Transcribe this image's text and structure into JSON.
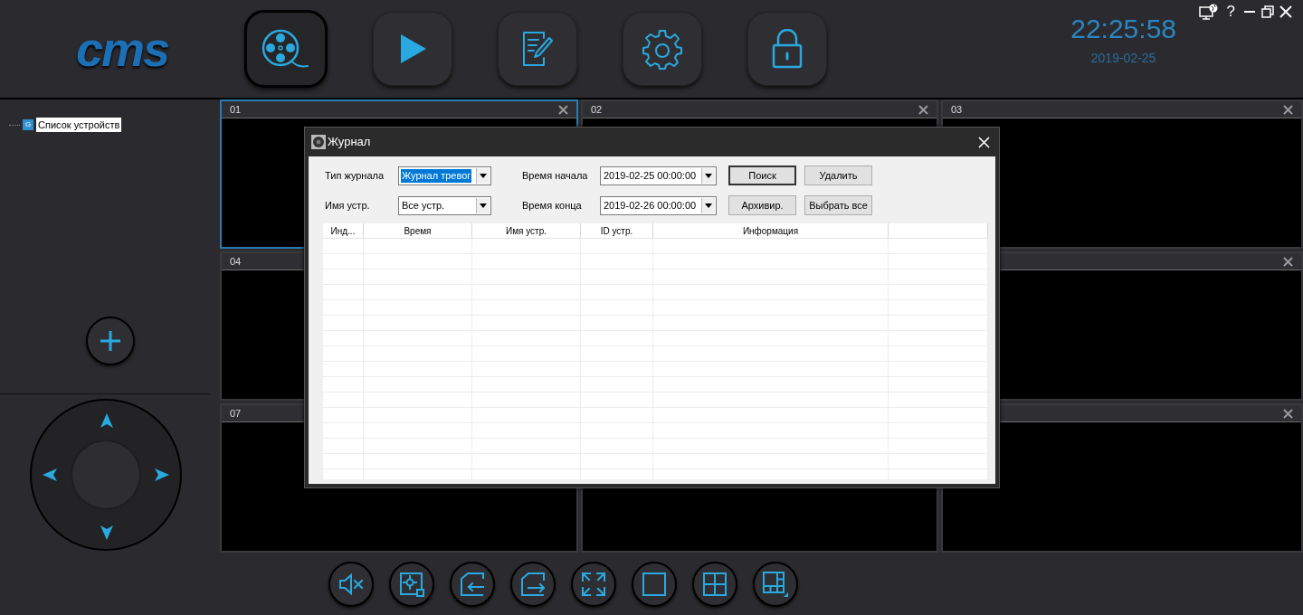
{
  "logo": {
    "text": "cms"
  },
  "nav_buttons": [
    {
      "kind": "reel",
      "selected": true
    },
    {
      "kind": "play",
      "selected": false
    },
    {
      "kind": "log",
      "selected": false
    },
    {
      "kind": "gear",
      "selected": false
    },
    {
      "kind": "lock",
      "selected": false
    }
  ],
  "clock": {
    "time": "22:25:58",
    "date": "2019-02-25"
  },
  "window_controls": {
    "help": "?"
  },
  "device_tree": [
    {
      "badge": "G",
      "label": "Список устройств",
      "selected": true
    }
  ],
  "video_cells": [
    {
      "label": "01",
      "selected": true
    },
    {
      "label": "02",
      "selected": false
    },
    {
      "label": "03",
      "selected": false
    },
    {
      "label": "04",
      "selected": false
    },
    {},
    {},
    {
      "label": "07",
      "selected": false
    },
    {},
    {}
  ],
  "dialog": {
    "title": "Журнал",
    "filter_rows": [
      {
        "label": "Тип журнала",
        "value": "Журнал тревог",
        "highlighted": true,
        "label_2": "Время начала",
        "value_2": "2019-02-25 00:00:00",
        "buttons": [
          {
            "label": "Поиск",
            "default": true
          },
          {
            "label": "Удалить",
            "default": false
          }
        ]
      },
      {
        "label": "Имя устр.",
        "value": "Все устр.",
        "highlighted": false,
        "label_2": "Время конца",
        "value_2": "2019-02-26 00:00:00",
        "buttons": [
          {
            "label": "Архивир.",
            "default": false
          },
          {
            "label": "Выбрать все",
            "default": false
          }
        ]
      }
    ],
    "table": {
      "columns": [
        "Инд...",
        "Время",
        "Имя устр.",
        "ID устр.",
        "Информация"
      ]
    }
  },
  "toolbar": [
    {
      "kind": "mute"
    },
    {
      "kind": "focus"
    },
    {
      "kind": "import"
    },
    {
      "kind": "export"
    },
    {
      "kind": "fullscreen"
    },
    {
      "kind": "single"
    },
    {
      "kind": "quad"
    },
    {
      "kind": "multi"
    }
  ]
}
